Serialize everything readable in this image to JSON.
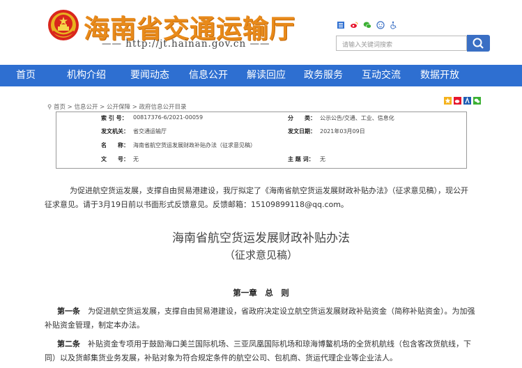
{
  "header": {
    "site_title": "海南省交通运输厅",
    "site_url": "—— http://jt.hainan.gov.cn ——",
    "search_placeholder": "请输入关键词搜索",
    "icons": [
      "accessibility-icon",
      "weibo-icon",
      "wechat-icon",
      "elderly-icon",
      "barrier-free-icon"
    ]
  },
  "nav": {
    "items": [
      "首页",
      "机构介绍",
      "要闻动态",
      "信息公开",
      "解读回应",
      "政务服务",
      "互动交流",
      "数据开放"
    ]
  },
  "breadcrumb": "首页 > 信息公开 > 公开保障 > 政府信息公开目录",
  "info": {
    "index_label": "索 引 号：",
    "index_value": "00817376-6/2021-00059",
    "category_label": "分　　类：",
    "category_value": "公示公告/交通、工业、信息化",
    "issuer_label": "发文机关：",
    "issuer_value": "省交通运输厅",
    "date_label": "发文日期：",
    "date_value": "2021年03月09日",
    "name_label": "名　　称：",
    "name_value": "海南省航空货运发展财政补贴办法（征求意见稿）",
    "docno_label": "文　　号：",
    "docno_value": "无",
    "keyword_label": "主 题 词：",
    "keyword_value": "无"
  },
  "intro": "为促进航空货运发展，支撑自由贸易港建设，我厅拟定了《海南省航空货运发展财政补贴办法》（征求意见稿），现公开征求意见。请于3月19日前以书面形式反馈意见。反馈邮箱：15109899118@qq.com。",
  "doc_title": "海南省航空货运发展财政补贴办法",
  "doc_subtitle": "（征求意见稿）",
  "chapter": "第一章　总　则",
  "article1": {
    "label": "第一条",
    "text": "为促进航空货运发展，支撑自由贸易港建设，省政府决定设立航空货运发展财政补贴资金（简称补贴资金）。为加强补贴资金管理，制定本办法。"
  },
  "article2": {
    "label": "第二条",
    "text": "补贴资金专项用于鼓励海口美兰国际机场、三亚凤凰国际机场和琼海博鳌机场的全货机航线（包含客改货航线，下同）以及货邮集货业务发展，补贴对象为符合规定条件的航空公司、包机商、货运代理企业等企业法人。"
  }
}
